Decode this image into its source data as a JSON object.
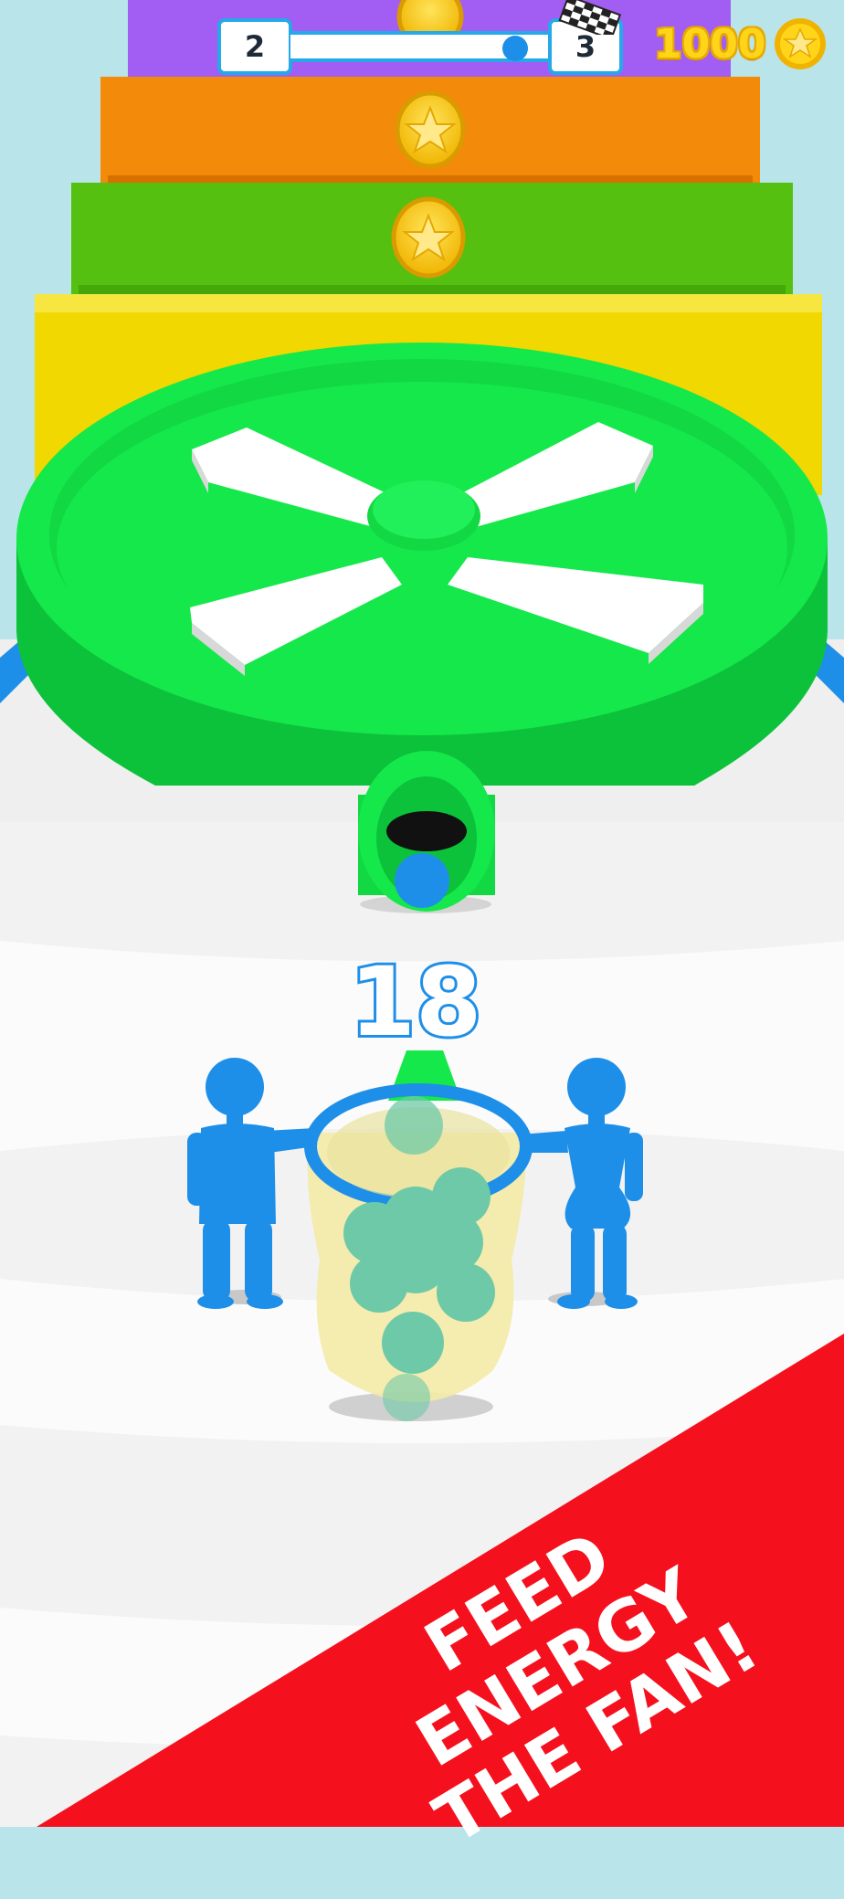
{
  "hud": {
    "level_current": "2",
    "level_next": "3",
    "progress": 0.9,
    "coins": "1000"
  },
  "game": {
    "ball_count": "18",
    "obstacle": "fan"
  },
  "promo_banner": {
    "line1": "FEED ENERGY",
    "line2": "THE FAN!"
  },
  "colors": {
    "fan": "#15e84a",
    "fan_dark": "#0cc23a",
    "player": "#1e8fe8",
    "banner": "#f5101e",
    "step_purple": "#a25df3",
    "step_orange": "#f38a0a",
    "step_green": "#55c010",
    "step_yellow": "#f0d800",
    "coin": "#ffd51a"
  }
}
